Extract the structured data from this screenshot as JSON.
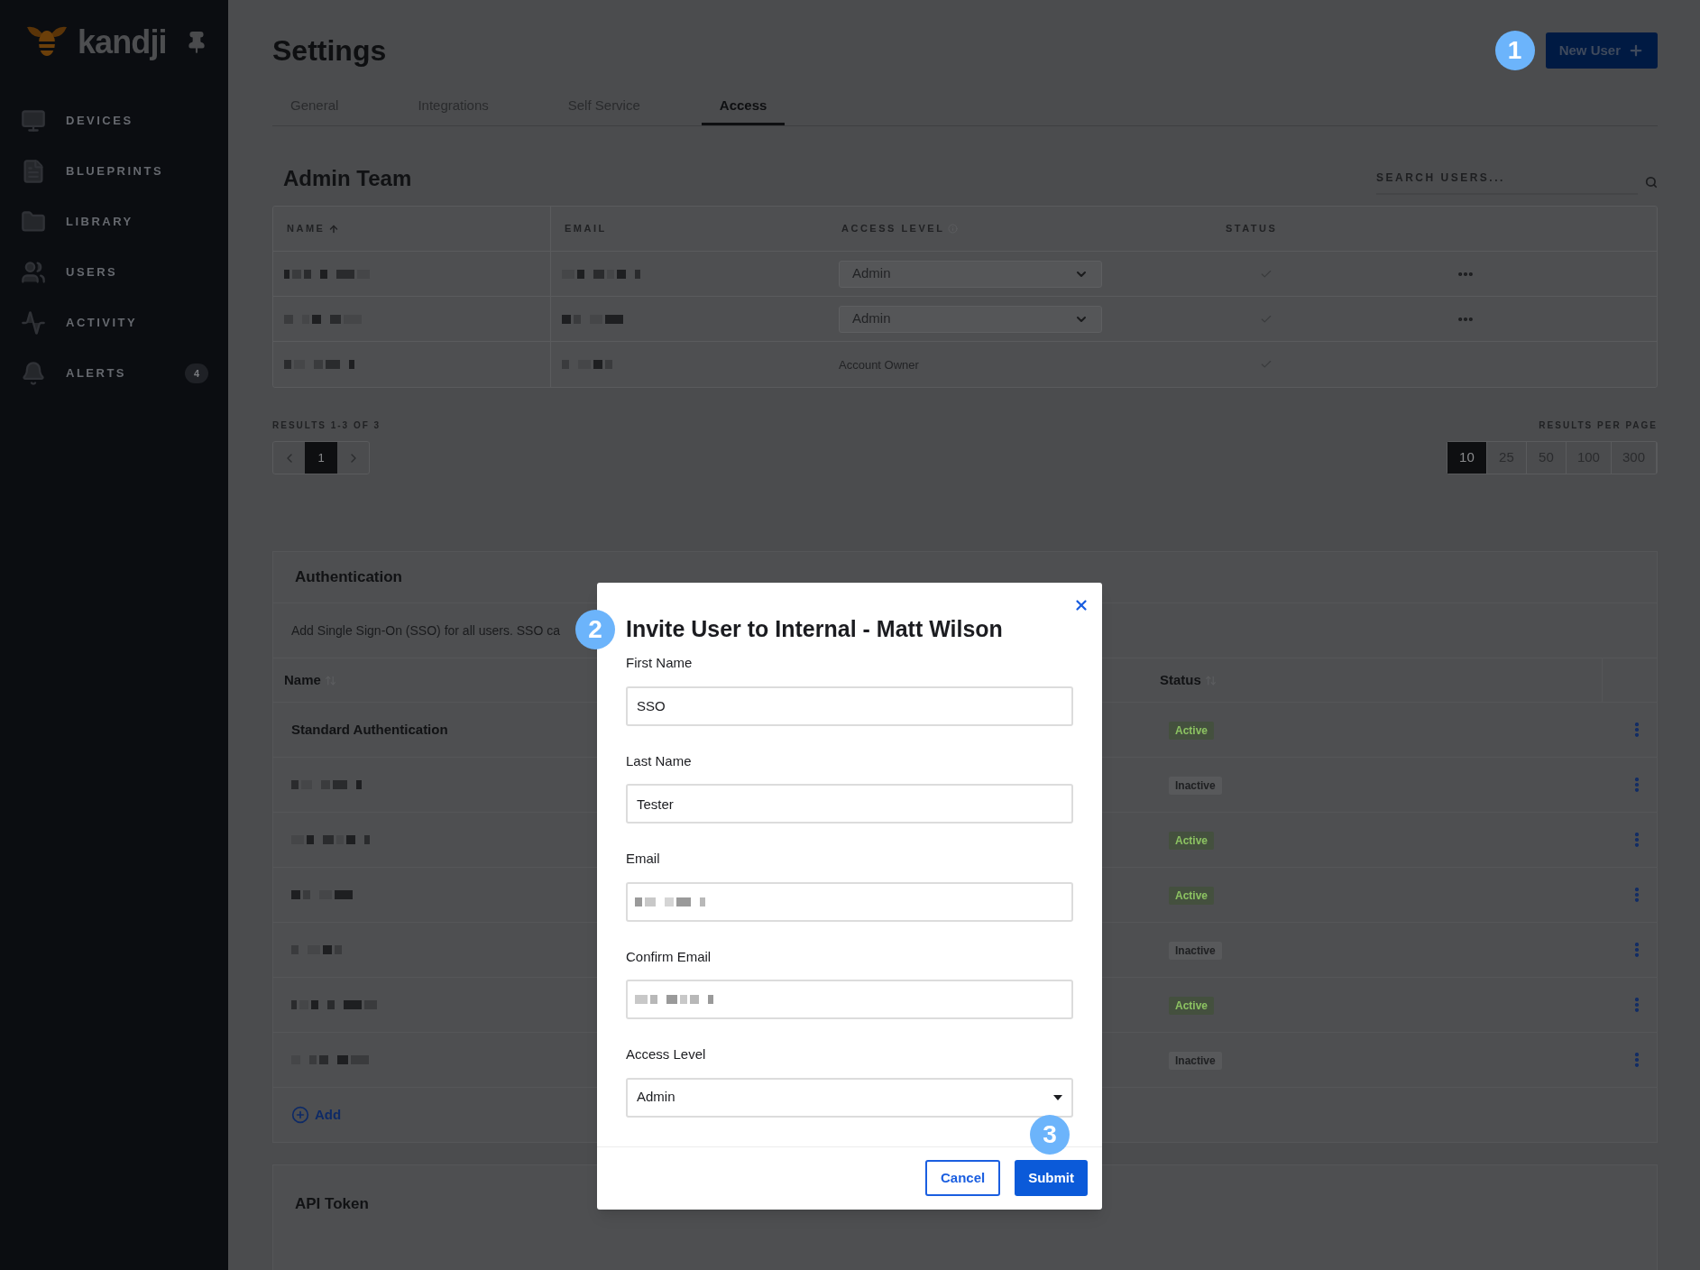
{
  "sidebar": {
    "logo": "kandji",
    "items": [
      {
        "label": "DEVICES"
      },
      {
        "label": "BLUEPRINTS"
      },
      {
        "label": "LIBRARY"
      },
      {
        "label": "USERS"
      },
      {
        "label": "ACTIVITY"
      },
      {
        "label": "ALERTS",
        "badge": "4"
      }
    ]
  },
  "header": {
    "title": "Settings",
    "new_user_button": "New User",
    "callout": "1"
  },
  "tabs": [
    {
      "label": "General",
      "selected": false
    },
    {
      "label": "Integrations",
      "selected": false
    },
    {
      "label": "Self Service",
      "selected": false
    },
    {
      "label": "Access",
      "selected": true
    }
  ],
  "admin_team": {
    "title": "Admin Team",
    "search": {
      "placeholder": "SEARCH USERS..."
    },
    "columns": [
      "NAME",
      "EMAIL",
      "ACCESS LEVEL",
      "STATUS"
    ],
    "rows": [
      {
        "kind": "select",
        "access": "Admin",
        "active": true,
        "menu": true
      },
      {
        "kind": "select",
        "access": "Admin",
        "active": true,
        "menu": true
      },
      {
        "kind": "text",
        "access": "Account Owner",
        "active": true,
        "menu": false
      }
    ],
    "results": "RESULTS 1-3 OF 3",
    "pages": [
      {
        "label": "1",
        "selected": true
      }
    ],
    "per_page_label": "RESULTS PER PAGE",
    "per_page": [
      {
        "label": "10",
        "selected": true
      },
      {
        "label": "25",
        "selected": false
      },
      {
        "label": "50",
        "selected": false
      },
      {
        "label": "100",
        "selected": false
      },
      {
        "label": "300",
        "selected": false
      }
    ]
  },
  "authentication": {
    "title": "Authentication",
    "description": "Add Single Sign-On (SSO) for all users. SSO ca",
    "columns": [
      "Name",
      "Status"
    ],
    "rows": [
      {
        "name": "Standard Authentication",
        "status": "Active",
        "active": true
      },
      {
        "status": "Inactive",
        "active": false
      },
      {
        "status": "Active",
        "active": true
      },
      {
        "status": "Active",
        "active": true
      },
      {
        "status": "Inactive",
        "active": false
      },
      {
        "status": "Active",
        "active": true
      },
      {
        "status": "Inactive",
        "active": false
      }
    ],
    "add_link": "Add"
  },
  "api_token": {
    "title": "API Token"
  },
  "modal": {
    "title": "Invite User to Internal - Matt Wilson",
    "callout": "2",
    "fields": [
      {
        "label": "First Name",
        "kind": "text",
        "value": "SSO"
      },
      {
        "label": "Last Name",
        "kind": "text",
        "value": "Tester"
      },
      {
        "label": "Email",
        "kind": "redacted"
      },
      {
        "label": "Confirm Email",
        "kind": "redacted"
      },
      {
        "label": "Access Level",
        "kind": "select",
        "value": "Admin"
      }
    ],
    "cancel": "Cancel",
    "submit": "Submit",
    "submit_callout": "3"
  }
}
